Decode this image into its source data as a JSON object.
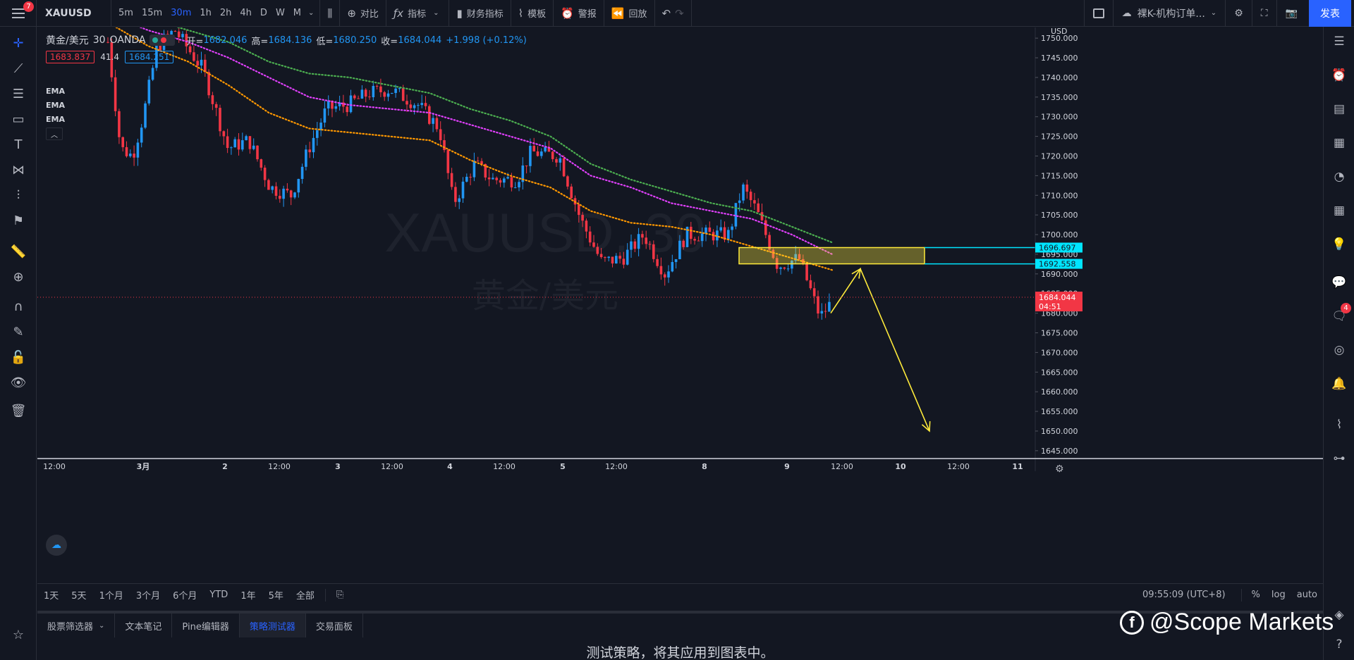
{
  "header": {
    "menu_badge": "7",
    "symbol": "XAUUSD",
    "timeframes": [
      "5m",
      "15m",
      "30m",
      "1h",
      "2h",
      "4h",
      "D",
      "W",
      "M"
    ],
    "active_timeframe": "30m",
    "compare_label": "对比",
    "indicators_label": "指标",
    "financials_label": "财务指标",
    "templates_label": "模板",
    "alert_label": "警报",
    "replay_label": "回放",
    "layout_name": "裸K-机构订单...",
    "publish_label": "发表"
  },
  "legend": {
    "title": "黄金/美元",
    "interval": "30",
    "exchange": "OANDA",
    "open_label": "开=",
    "open": "1682.046",
    "high_label": "高=",
    "high": "1684.136",
    "low_label": "低=",
    "low": "1680.250",
    "close_label": "收=",
    "close": "1684.044",
    "change": "+1.998 (+0.12%)",
    "sell_price": "1683.837",
    "spread": "41.4",
    "buy_price": "1684.251",
    "indicators": [
      "EMA",
      "EMA",
      "EMA"
    ]
  },
  "watermark": {
    "line1": "XAUUSD, 30",
    "line2": "黄金/美元"
  },
  "price_axis": {
    "currency": "USD",
    "labels": [
      "1750.000",
      "1745.000",
      "1740.000",
      "1735.000",
      "1730.000",
      "1725.000",
      "1720.000",
      "1715.000",
      "1710.000",
      "1705.000",
      "1700.000",
      "1695.000",
      "1690.000",
      "1685.000",
      "1680.000",
      "1675.000",
      "1670.000",
      "1665.000",
      "1660.000",
      "1655.000",
      "1650.000",
      "1645.000"
    ],
    "zone_top": "1696.697",
    "zone_bottom": "1692.558",
    "current_price": "1684.044",
    "countdown": "04:51"
  },
  "time_axis": {
    "labels": [
      "12:00",
      "3月",
      "2",
      "12:00",
      "3",
      "12:00",
      "4",
      "12:00",
      "5",
      "12:00",
      "8",
      "9",
      "12:00",
      "10",
      "12:00",
      "11"
    ]
  },
  "range_bar": {
    "ranges": [
      "1天",
      "5天",
      "1个月",
      "3个月",
      "6个月",
      "YTD",
      "1年",
      "5年",
      "全部"
    ],
    "clock": "09:55:09 (UTC+8)",
    "opt_percent": "%",
    "opt_log": "log",
    "opt_auto": "auto"
  },
  "bottom_tabs": [
    "股票筛选器",
    "文本笔记",
    "Pine编辑器",
    "策略测试器",
    "交易面板"
  ],
  "active_bottom_tab": "策略测试器",
  "strategy_message": "测试策略，将其应用到图表中。",
  "brand": "@Scope Markets",
  "right_badge": "4",
  "colors": {
    "background": "#131722",
    "up": "#2196f3",
    "down": "#f23645",
    "ema_fast": "#ff9800",
    "ema_mid": "#e040fb",
    "ema_slow": "#4caf50",
    "zone": "#ffeb3b",
    "accent": "#2962ff"
  },
  "chart_data": {
    "type": "candlestick",
    "symbol": "XAUUSD",
    "interval": "30",
    "ylim": [
      1643,
      1752
    ],
    "ohlc_last": {
      "open": 1682.046,
      "high": 1684.136,
      "low": 1680.25,
      "close": 1684.044
    },
    "ema_fast": [
      1754,
      1748,
      1744,
      1738,
      1731,
      1727,
      1726,
      1725,
      1724,
      1719,
      1715,
      1712,
      1706,
      1703,
      1702,
      1700,
      1697,
      1694,
      1691
    ],
    "ema_mid": [
      1756,
      1752,
      1749,
      1745,
      1740,
      1735,
      1733,
      1732,
      1731,
      1728,
      1725,
      1722,
      1715,
      1712,
      1708,
      1706,
      1704,
      1700,
      1695
    ],
    "ema_slow": [
      1758,
      1755,
      1752,
      1749,
      1744,
      1741,
      1740,
      1738,
      1736,
      1732,
      1729,
      1725,
      1718,
      1714,
      1711,
      1708,
      1706,
      1702,
      1698
    ],
    "supply_zone": [
      1692.558,
      1696.697
    ],
    "projected_path": [
      1680,
      1692,
      1650
    ]
  }
}
